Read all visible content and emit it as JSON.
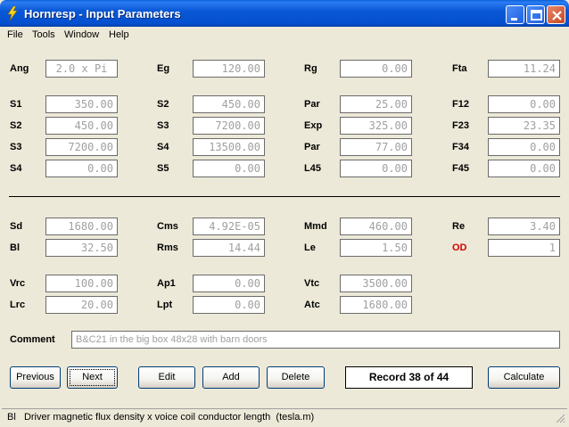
{
  "window": {
    "title": "Hornresp - Input Parameters"
  },
  "menu": [
    "File",
    "Tools",
    "Window",
    "Help"
  ],
  "fields": {
    "Ang": "2.0 x Pi",
    "Eg": "120.00",
    "Rg": "0.00",
    "Fta": "11.24",
    "S1": "350.00",
    "S2a": "450.00",
    "Par1": "25.00",
    "F12": "0.00",
    "S2b": "450.00",
    "S3a": "7200.00",
    "Exp": "325.00",
    "F23": "23.35",
    "S3b": "7200.00",
    "S4a": "13500.00",
    "Par2": "77.00",
    "F34": "0.00",
    "S4b": "0.00",
    "S5": "0.00",
    "L45": "0.00",
    "F45": "0.00",
    "Sd": "1680.00",
    "Cms": "4.92E-05",
    "Mmd": "460.00",
    "Re": "3.40",
    "Bl": "32.50",
    "Rms": "14.44",
    "Le": "1.50",
    "OD": "1",
    "Vrc": "100.00",
    "Ap1": "0.00",
    "Vtc": "3500.00",
    "Lrc": "20.00",
    "Lpt": "0.00",
    "Atc": "1680.00"
  },
  "labels": {
    "Ang": "Ang",
    "Eg": "Eg",
    "Rg": "Rg",
    "Fta": "Fta",
    "S1": "S1",
    "S2a": "S2",
    "Par1": "Par",
    "F12": "F12",
    "S2b": "S2",
    "S3a": "S3",
    "Exp": "Exp",
    "F23": "F23",
    "S3b": "S3",
    "S4a": "S4",
    "Par2": "Par",
    "F34": "F34",
    "S4b": "S4",
    "S5": "S5",
    "L45": "L45",
    "F45": "F45",
    "Sd": "Sd",
    "Cms": "Cms",
    "Mmd": "Mmd",
    "Re": "Re",
    "Bl": "Bl",
    "Rms": "Rms",
    "Le": "Le",
    "OD": "OD",
    "Vrc": "Vrc",
    "Ap1": "Ap1",
    "Vtc": "Vtc",
    "Lrc": "Lrc",
    "Lpt": "Lpt",
    "Atc": "Atc"
  },
  "comment": {
    "label": "Comment",
    "value": "B&C21 in the big box 48x28 with barn doors"
  },
  "buttons": {
    "previous": "Previous",
    "next": "Next",
    "edit": "Edit",
    "add": "Add",
    "delete": "Delete",
    "calculate": "Calculate"
  },
  "record": "Record 38 of 44",
  "status": "Bl   Driver magnetic flux density x voice coil conductor length  (tesla.m)",
  "colors": {
    "title_blue": "#0450d0",
    "od_label": "#d40000",
    "value_text": "#a0a0a0",
    "face": "#ece9d8"
  }
}
